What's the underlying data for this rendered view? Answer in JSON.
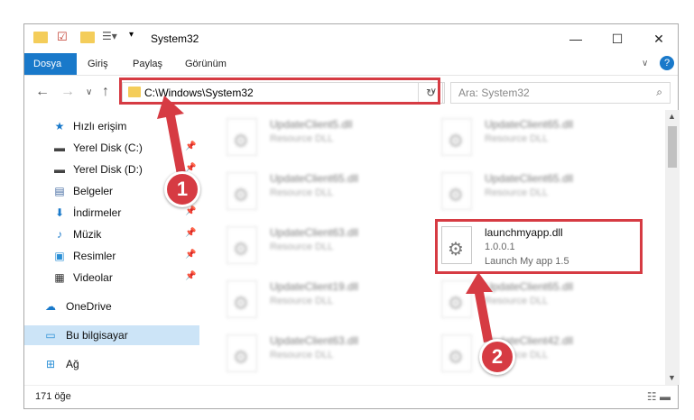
{
  "window": {
    "title": "System32",
    "controls": {
      "minimize": "—",
      "maximize": "☐",
      "close": "✕"
    }
  },
  "ribbon": {
    "tabs": [
      "Dosya",
      "Giriş",
      "Paylaş",
      "Görünüm"
    ],
    "help": "?"
  },
  "address": {
    "path": "C:\\Windows\\System32",
    "search_placeholder": "Ara: System32"
  },
  "sidebar": {
    "items": [
      {
        "label": "Hızlı erişim",
        "icon": "star-icon",
        "pinned": false
      },
      {
        "label": "Yerel Disk (C:)",
        "icon": "drive-icon",
        "pinned": true
      },
      {
        "label": "Yerel Disk (D:)",
        "icon": "drive-icon",
        "pinned": true
      },
      {
        "label": "Belgeler",
        "icon": "documents-icon",
        "pinned": true
      },
      {
        "label": "İndirmeler",
        "icon": "download-icon",
        "pinned": true
      },
      {
        "label": "Müzik",
        "icon": "music-icon",
        "pinned": true
      },
      {
        "label": "Resimler",
        "icon": "pictures-icon",
        "pinned": true
      },
      {
        "label": "Videolar",
        "icon": "videos-icon",
        "pinned": true
      },
      {
        "label": "OneDrive",
        "icon": "cloud-icon",
        "pinned": false
      },
      {
        "label": "Bu bilgisayar",
        "icon": "computer-icon",
        "pinned": false,
        "selected": true
      },
      {
        "label": "Ağ",
        "icon": "network-icon",
        "pinned": false
      }
    ]
  },
  "files": {
    "left": [
      {
        "name": "UpdateClient5.dll",
        "desc": "Resource DLL"
      },
      {
        "name": "UpdateClient65.dll",
        "desc": "Resource DLL"
      },
      {
        "name": "UpdateClient63.dll",
        "desc": "Resource DLL"
      },
      {
        "name": "UpdateClient19.dll",
        "desc": "Resource DLL"
      },
      {
        "name": "UpdateClient63.dll",
        "desc": "Resource DLL"
      }
    ],
    "right": [
      {
        "name": "UpdateClient65.dll",
        "desc": "Resource DLL"
      },
      {
        "name": "UpdateClient65.dll",
        "desc": "Resource DLL"
      },
      {
        "name": "launchmyapp.dll",
        "desc": "1.0.0.1",
        "extra": "Launch My app 1.5",
        "highlight": true
      },
      {
        "name": "UpdateClient65.dll",
        "desc": "Resource DLL"
      },
      {
        "name": "UpdateClient42.dll",
        "desc": "Resource DLL"
      }
    ]
  },
  "status": {
    "count": "171 öğe"
  },
  "annotations": {
    "badge1": "1",
    "badge2": "2"
  },
  "colors": {
    "accent": "#1979ca",
    "annotation_red": "#d63b43",
    "selection": "#cce4f7"
  }
}
